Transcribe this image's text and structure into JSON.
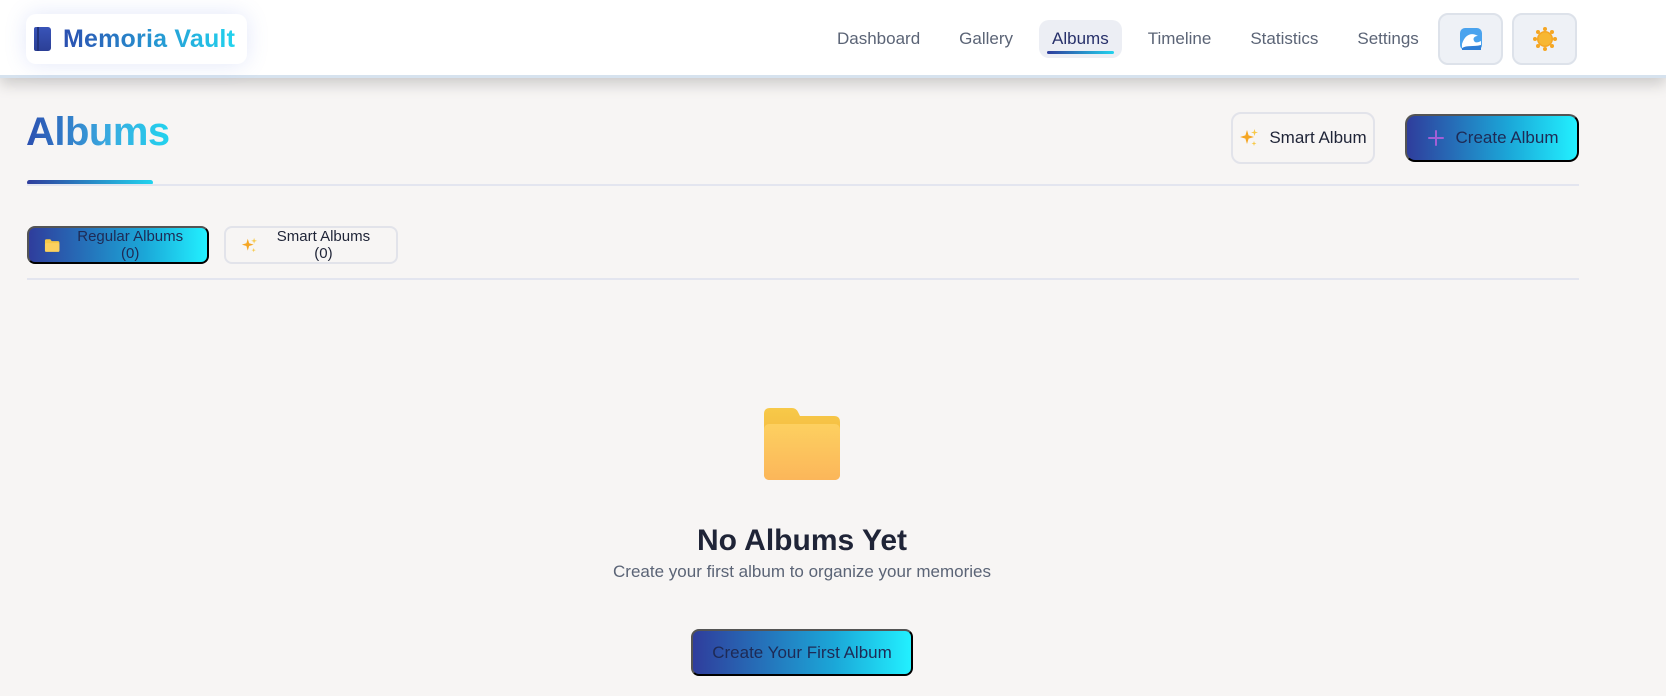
{
  "app": {
    "name": "Memoria Vault",
    "logo_icon": "book-icon"
  },
  "nav": {
    "items": [
      {
        "label": "Dashboard",
        "active": false
      },
      {
        "label": "Gallery",
        "active": false
      },
      {
        "label": "Albums",
        "active": true
      },
      {
        "label": "Timeline",
        "active": false
      },
      {
        "label": "Statistics",
        "active": false
      },
      {
        "label": "Settings",
        "active": false
      }
    ],
    "theme_icons": [
      "wave-theme-icon",
      "sun-theme-icon"
    ]
  },
  "page": {
    "title": "Albums",
    "smart_album_label": "Smart Album",
    "create_album_label": "Create Album"
  },
  "tabs": [
    {
      "label": "Regular Albums (0)",
      "icon": "folder-icon",
      "active": true
    },
    {
      "label": "Smart Albums (0)",
      "icon": "sparkles-icon",
      "active": false
    }
  ],
  "empty_state": {
    "icon": "folder-icon",
    "title": "No Albums Yet",
    "subtitle": "Create your first album to organize your memories",
    "cta_label": "Create Your First Album"
  },
  "colors": {
    "brand_gradient_start": "#2f3d9c",
    "brand_gradient_end": "#22d3ee",
    "background": "#f7f5f4"
  }
}
